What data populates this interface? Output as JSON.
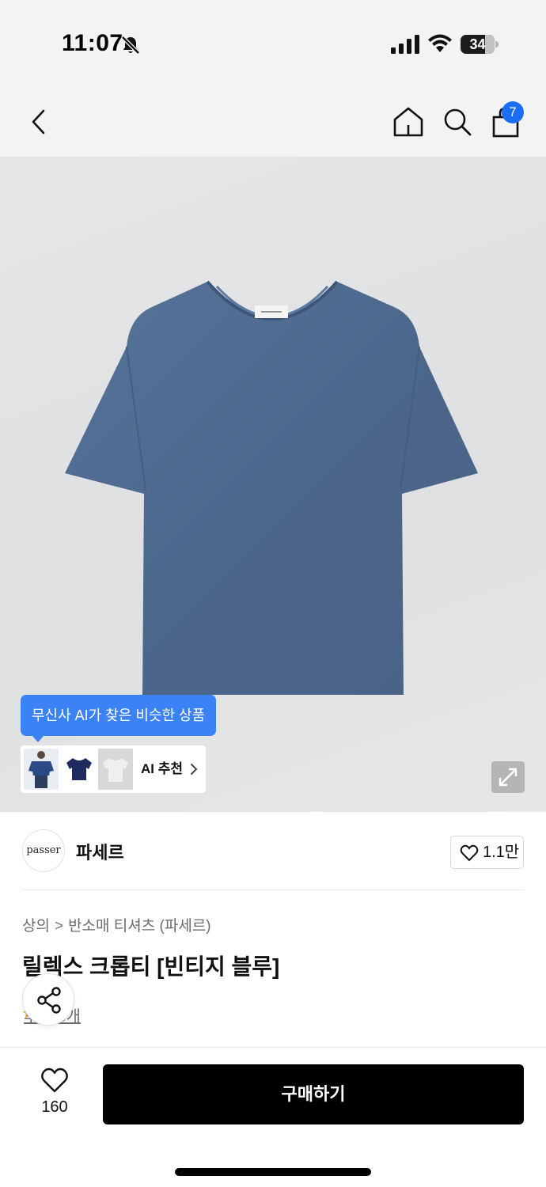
{
  "status_bar": {
    "time": "11:07",
    "battery": "34",
    "icons": [
      "bell-off-icon",
      "signal-icon",
      "wifi-icon",
      "battery-icon"
    ]
  },
  "navbar": {
    "icons": [
      "back-chevron-icon",
      "home-icon",
      "search-icon",
      "shopping-bag-icon"
    ],
    "cart_badge": "7",
    "badge_color": "#1b6ef3"
  },
  "ai_recommend": {
    "tooltip": "무신사 AI가 찾은 비슷한 상품",
    "label": "AI 추천",
    "tooltip_color": "#3b82f6"
  },
  "brand": {
    "logo_text": "passer",
    "name": "파세르",
    "likes": "1.1만"
  },
  "product": {
    "breadcrumb": [
      "상의",
      "반소매 티셔츠 (파세르)"
    ],
    "title": "릴렉스 크롭티 [빈티지 블루]",
    "review": "후기 3개",
    "shirt_color": "#4f6a8c"
  },
  "bottom_bar": {
    "fav_count": "160",
    "buy_label": "구매하기"
  }
}
